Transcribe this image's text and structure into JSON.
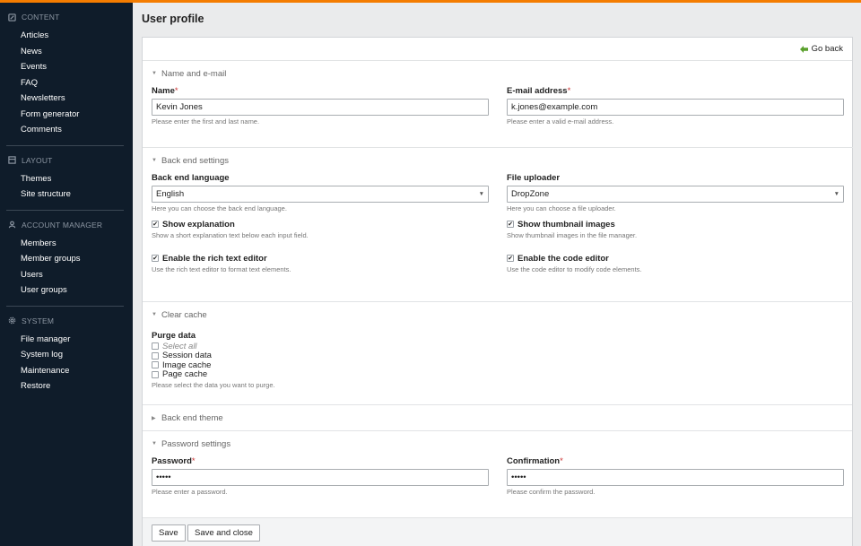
{
  "sidebar": {
    "groups": [
      {
        "heading": "Content",
        "icon": "edit-icon",
        "items": [
          "Articles",
          "News",
          "Events",
          "FAQ",
          "Newsletters",
          "Form generator",
          "Comments"
        ]
      },
      {
        "heading": "Layout",
        "icon": "layout-icon",
        "items": [
          "Themes",
          "Site structure"
        ]
      },
      {
        "heading": "Account Manager",
        "icon": "user-icon",
        "items": [
          "Members",
          "Member groups",
          "Users",
          "User groups"
        ]
      },
      {
        "heading": "System",
        "icon": "gear-icon",
        "items": [
          "File manager",
          "System log",
          "Maintenance",
          "Restore"
        ]
      }
    ]
  },
  "page": {
    "title": "User profile",
    "go_back": "Go back"
  },
  "sections": {
    "name": {
      "legend": "Name and e-mail",
      "name_label": "Name",
      "name_value": "Kevin Jones",
      "name_help": "Please enter the first and last name.",
      "email_label": "E-mail address",
      "email_value": "k.jones@example.com",
      "email_help": "Please enter a valid e-mail address."
    },
    "backend": {
      "legend": "Back end settings",
      "language_label": "Back end language",
      "language_value": "English",
      "language_help": "Here you can choose the back end language.",
      "uploader_label": "File uploader",
      "uploader_value": "DropZone",
      "uploader_help": "Here you can choose a file uploader.",
      "show_explanation_label": "Show explanation",
      "show_explanation_help": "Show a short explanation text below each input field.",
      "show_thumbnails_label": "Show thumbnail images",
      "show_thumbnails_help": "Show thumbnail images in the file manager.",
      "rte_label": "Enable the rich text editor",
      "rte_help": "Use the rich text editor to format text elements.",
      "code_label": "Enable the code editor",
      "code_help": "Use the code editor to modify code elements."
    },
    "cache": {
      "legend": "Clear cache",
      "purge_label": "Purge data",
      "select_all": "Select all",
      "options": [
        "Session data",
        "Image cache",
        "Page cache"
      ],
      "help": "Please select the data you want to purge."
    },
    "theme": {
      "legend": "Back end theme"
    },
    "password": {
      "legend": "Password settings",
      "password_label": "Password",
      "password_value": "•••••",
      "password_help": "Please enter a password.",
      "confirm_label": "Confirmation",
      "confirm_value": "•••••",
      "confirm_help": "Please confirm the password."
    }
  },
  "buttons": {
    "save": "Save",
    "save_close": "Save and close"
  },
  "required_mark": "*",
  "colors": {
    "accent": "#f47c00",
    "sidebar": "#0f1c2a",
    "go_back_arrow": "#5aa02c",
    "required": "#cc3333"
  }
}
